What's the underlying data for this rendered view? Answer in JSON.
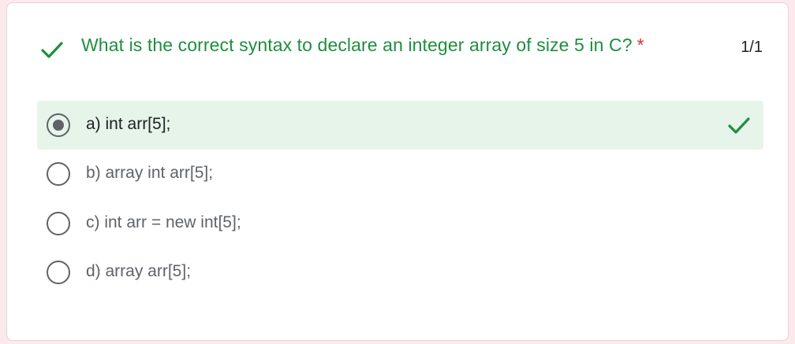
{
  "question": {
    "title": "What is the correct syntax to declare an integer array of size 5 in C?",
    "required_marker": "*",
    "score": "1/1",
    "status_icon": "checkmark-icon"
  },
  "options": [
    {
      "label": "a) int arr[5];",
      "selected": true,
      "correct": true
    },
    {
      "label": "b) array int arr[5];",
      "selected": false,
      "correct": false
    },
    {
      "label": "c) int arr = new int[5];",
      "selected": false,
      "correct": false
    },
    {
      "label": "d) array arr[5];",
      "selected": false,
      "correct": false
    }
  ],
  "colors": {
    "correct_text": "#1e8e3e",
    "correct_bg": "#e6f4ea",
    "required": "#d93025",
    "page_bg": "#fbe9ec"
  }
}
